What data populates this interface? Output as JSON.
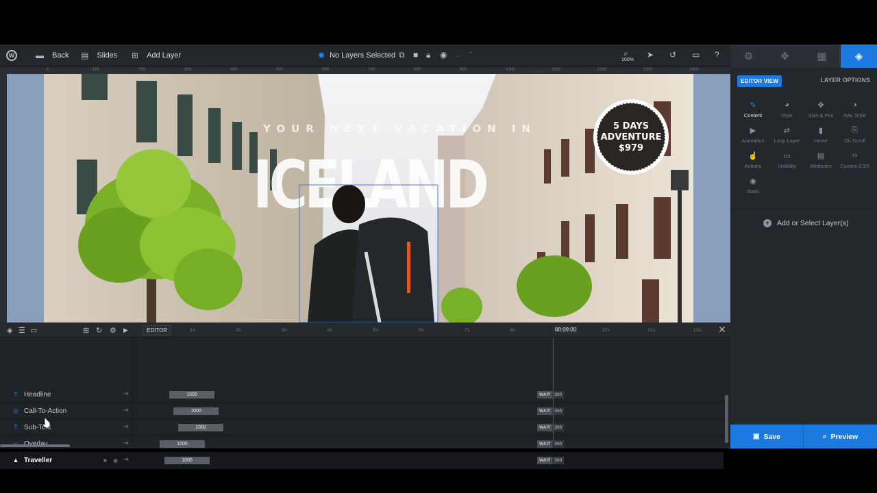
{
  "toolbar": {
    "back_label": "Back",
    "slides_label": "Slides",
    "add_layer_label": "Add Layer",
    "layer_status": "No Layers Selected",
    "zoom": "100%"
  },
  "canvas": {
    "ruler_marks": [
      "0",
      "100",
      "200",
      "300",
      "400",
      "500",
      "600",
      "700",
      "800",
      "900",
      "1000",
      "1100",
      "1200",
      "1300",
      "1400"
    ],
    "slide": {
      "subtitle": "YOUR NEXT VACATION IN",
      "headline": "ICELAND",
      "badge_line1": "5 DAYS",
      "badge_line2": "ADVENTURE",
      "badge_line3": "$979"
    }
  },
  "right_panel": {
    "editor_view_label": "EDITOR VIEW",
    "layer_options_label": "LAYER OPTIONS",
    "options": [
      {
        "label": "Content",
        "icon": "pencil-icon",
        "glyph": "✎"
      },
      {
        "label": "Style",
        "icon": "palette-icon",
        "glyph": "◕"
      },
      {
        "label": "Size & Pos",
        "icon": "move-icon",
        "glyph": "✥"
      },
      {
        "label": "Adv. Style",
        "icon": "contrast-icon",
        "glyph": "◑"
      },
      {
        "label": "Animation",
        "icon": "play-icon",
        "glyph": "▶"
      },
      {
        "label": "Loop Layer",
        "icon": "loop-icon",
        "glyph": "⇄"
      },
      {
        "label": "Hover",
        "icon": "mouse-icon",
        "glyph": "▮"
      },
      {
        "label": "On Scroll",
        "icon": "scroll-icon",
        "glyph": "⎘"
      },
      {
        "label": "Actions",
        "icon": "hand-icon",
        "glyph": "☝"
      },
      {
        "label": "Visibility",
        "icon": "monitor-icon",
        "glyph": "▭"
      },
      {
        "label": "Attributes",
        "icon": "document-icon",
        "glyph": "▤"
      },
      {
        "label": "Custom CSS",
        "icon": "code-icon",
        "glyph": "‹›"
      },
      {
        "label": "Static",
        "icon": "target-icon",
        "glyph": "◉"
      }
    ],
    "add_select_label": "Add or Select Layer(s)",
    "save_label": "Save",
    "preview_label": "Preview"
  },
  "timeline": {
    "editor_tab": "EDITOR",
    "seconds": [
      "1s",
      "2s",
      "3s",
      "4s",
      "5s",
      "6s",
      "7s",
      "8s",
      "9s",
      "10s",
      "11s",
      "12s"
    ],
    "timecode": "00:09:00",
    "wait_label": "WAIT",
    "layers": [
      {
        "name": "Headline",
        "icon": "text-icon",
        "glyph": "T",
        "duration": "1000",
        "wait": "300"
      },
      {
        "name": "Call-To-Action",
        "icon": "button-icon",
        "glyph": "◎",
        "duration": "1000",
        "wait": "300"
      },
      {
        "name": "Sub-Text",
        "icon": "text-icon",
        "glyph": "T",
        "duration": "1000",
        "wait": "300"
      },
      {
        "name": "Overlay",
        "icon": "shape-icon",
        "glyph": "▭",
        "duration": "1000",
        "wait": "300"
      },
      {
        "name": "Traveller",
        "icon": "image-icon",
        "glyph": "▲",
        "duration": "1000",
        "wait": "300"
      }
    ]
  },
  "colors": {
    "accent": "#1a7ae0",
    "panel_bg": "#24282d",
    "toolbar_bg": "#23272c",
    "canvas_bg": "#8a9fbe",
    "badge_bg": "#2a2522"
  }
}
